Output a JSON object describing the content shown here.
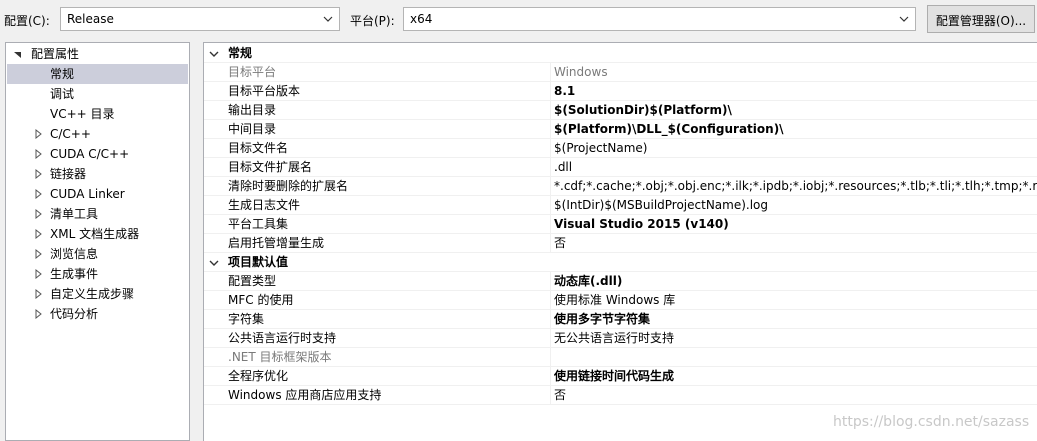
{
  "toolbar": {
    "config_label": "配置(C):",
    "config_value": "Release",
    "platform_label": "平台(P):",
    "platform_value": "x64",
    "config_manager_button": "配置管理器(O)..."
  },
  "tree": {
    "root": "配置属性",
    "items": [
      {
        "label": "常规"
      },
      {
        "label": "调试"
      },
      {
        "label": "VC++ 目录"
      },
      {
        "label": "C/C++"
      },
      {
        "label": "CUDA C/C++"
      },
      {
        "label": "链接器"
      },
      {
        "label": "CUDA Linker"
      },
      {
        "label": "清单工具"
      },
      {
        "label": "XML 文档生成器"
      },
      {
        "label": "浏览信息"
      },
      {
        "label": "生成事件"
      },
      {
        "label": "自定义生成步骤"
      },
      {
        "label": "代码分析"
      }
    ]
  },
  "grid": {
    "general": {
      "title": "常规",
      "rows": [
        {
          "name": "目标平台",
          "value": "Windows"
        },
        {
          "name": "目标平台版本",
          "value": "8.1"
        },
        {
          "name": "输出目录",
          "value": "$(SolutionDir)$(Platform)\\"
        },
        {
          "name": "中间目录",
          "value": "$(Platform)\\DLL_$(Configuration)\\"
        },
        {
          "name": "目标文件名",
          "value": "$(ProjectName)"
        },
        {
          "name": "目标文件扩展名",
          "value": ".dll"
        },
        {
          "name": "清除时要删除的扩展名",
          "value": "*.cdf;*.cache;*.obj;*.obj.enc;*.ilk;*.ipdb;*.iobj;*.resources;*.tlb;*.tli;*.tlh;*.tmp;*.rsp;*.pgc"
        },
        {
          "name": "生成日志文件",
          "value": "$(IntDir)$(MSBuildProjectName).log"
        },
        {
          "name": "平台工具集",
          "value": "Visual Studio 2015 (v140)"
        },
        {
          "name": "启用托管增量生成",
          "value": "否"
        }
      ]
    },
    "project_defaults": {
      "title": "项目默认值",
      "rows": [
        {
          "name": "配置类型",
          "value": "动态库(.dll)"
        },
        {
          "name": "MFC 的使用",
          "value": "使用标准 Windows 库"
        },
        {
          "name": "字符集",
          "value": "使用多字节字符集"
        },
        {
          "name": "公共语言运行时支持",
          "value": "无公共语言运行时支持"
        },
        {
          "name": ".NET 目标框架版本",
          "value": ""
        },
        {
          "name": "全程序优化",
          "value": "使用链接时间代码生成"
        },
        {
          "name": "Windows 应用商店应用支持",
          "value": "否"
        }
      ]
    }
  },
  "watermark": "https://blog.csdn.net/sazass",
  "icons": {
    "combo_dropdown": "chevron-down-icon",
    "tree_expanded": "triangle-down-icon",
    "tree_collapsed": "triangle-right-icon",
    "category_expanded": "chevron-down-icon"
  },
  "colors": {
    "selection": "#cccedb",
    "disabled_text": "#7a7a7a",
    "background": "#f0f0f0"
  }
}
